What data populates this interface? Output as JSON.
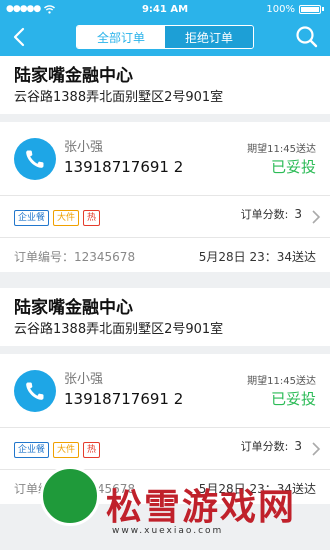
{
  "status_bar": {
    "dots": "●●●●●",
    "time": "9:41 AM",
    "battery": "100%"
  },
  "header": {
    "tabs": [
      {
        "label": "全部订单",
        "active": true
      },
      {
        "label": "拒绝订单",
        "active": false
      }
    ]
  },
  "orders": [
    {
      "place": "陆家嘴金融中心",
      "address": "云谷路1388弄北面别墅区2号901室",
      "customer_name": "张小强",
      "customer_phone": "13918717691 2",
      "expected": "期望11:45送达",
      "status": "已妥投",
      "tags": [
        "企业餐",
        "大件",
        "热"
      ],
      "score_label": "订单分数:",
      "score_value": "3",
      "order_no": "订单编号：12345678",
      "delivered_time": "5月28日 23：34送达"
    },
    {
      "place": "陆家嘴金融中心",
      "address": "云谷路1388弄北面别墅区2号901室",
      "customer_name": "张小强",
      "customer_phone": "13918717691 2",
      "expected": "期望11:45送达",
      "status": "已妥投",
      "tags": [
        "企业餐",
        "大件",
        "热"
      ],
      "score_label": "订单分数:",
      "score_value": "3",
      "order_no": "订单编号：12345678",
      "delivered_time": "5月28日 23：34送达"
    }
  ],
  "colors": {
    "primary": "#2bb3ea",
    "success": "#2bbb56"
  },
  "watermark": {
    "title": "松雪游戏网",
    "sub": "www.xuexiao.com"
  }
}
